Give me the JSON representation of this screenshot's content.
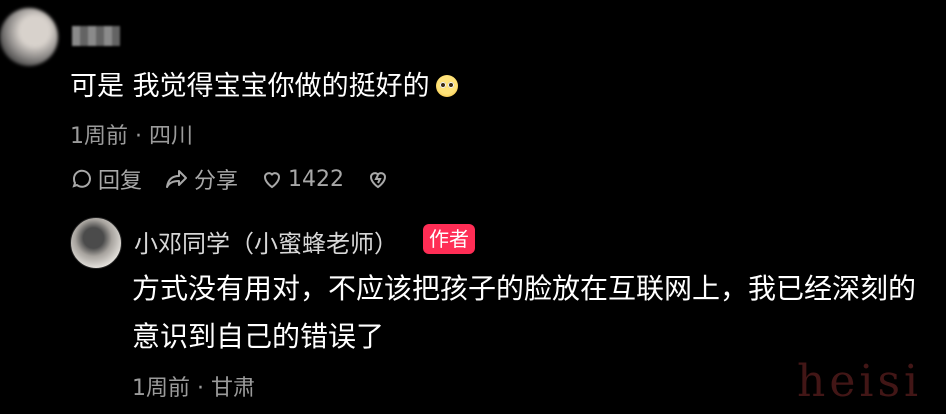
{
  "comment": {
    "text": "可是 我觉得宝宝你做的挺好的",
    "meta": "1周前 · 四川",
    "actions": {
      "reply_label": "回复",
      "share_label": "分享",
      "like_count": "1422"
    }
  },
  "reply": {
    "username": "小邓同学（小蜜蜂老师）",
    "badge": "作者",
    "text": "方式没有用对，不应该把孩子的脸放在互联网上，我已经深刻的意识到自己的错误了",
    "meta": "1周前 · 甘肃"
  },
  "watermark": "heisi",
  "icons": [
    "comment-icon",
    "share-icon",
    "heart-icon",
    "broken-heart-icon",
    "emoji-icon"
  ],
  "colors": {
    "background": "#000000",
    "text": "#ffffff",
    "muted": "#9b9b9b",
    "badge": "#ff2d55"
  }
}
